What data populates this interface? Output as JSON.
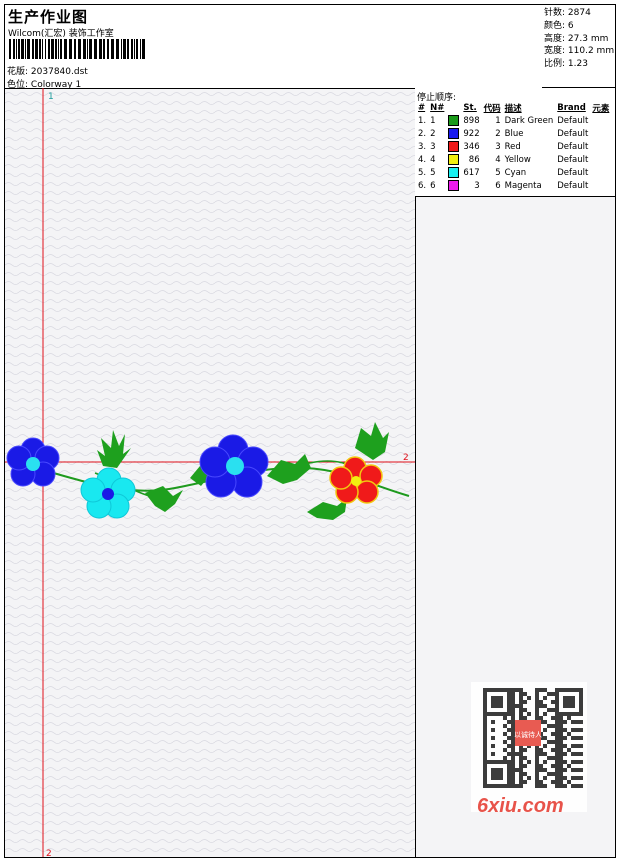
{
  "header": {
    "title": "生产作业图",
    "company": "Wilcom(汇宏) 装饰工作室",
    "design_label": "花版:",
    "design_value": "2037840.dst",
    "colorway_label": "色位:",
    "colorway_value": "Colorway 1"
  },
  "stats": [
    {
      "label": "针数:",
      "value": "2874"
    },
    {
      "label": "颜色:",
      "value": "6"
    },
    {
      "label": "高度:",
      "value": "27.3 mm"
    },
    {
      "label": "宽度:",
      "value": "110.2 mm"
    },
    {
      "label": "比例:",
      "value": "1.23"
    }
  ],
  "legend": {
    "title": "停止顺序:",
    "headers": [
      "#",
      "N#",
      "St.",
      "代码",
      "描述",
      "Brand",
      "元素"
    ],
    "rows": [
      {
        "n": "1.",
        "stop": "1",
        "color": "#1a9a1a",
        "st": "898",
        "code": "1",
        "desc": "Dark Green",
        "brand": "Default"
      },
      {
        "n": "2.",
        "stop": "2",
        "color": "#1a1aee",
        "st": "922",
        "code": "2",
        "desc": "Blue",
        "brand": "Default"
      },
      {
        "n": "3.",
        "stop": "3",
        "color": "#ee1a1a",
        "st": "346",
        "code": "3",
        "desc": "Red",
        "brand": "Default"
      },
      {
        "n": "4.",
        "stop": "4",
        "color": "#f2ee10",
        "st": "86",
        "code": "4",
        "desc": "Yellow",
        "brand": "Default"
      },
      {
        "n": "5.",
        "stop": "5",
        "color": "#19f0f0",
        "st": "617",
        "code": "5",
        "desc": "Cyan",
        "brand": "Default"
      },
      {
        "n": "6.",
        "stop": "6",
        "color": "#ee1aee",
        "st": "3",
        "code": "6",
        "desc": "Magenta",
        "brand": "Default"
      }
    ]
  },
  "canvas": {
    "marker_top": "1",
    "marker_bottom": "2",
    "marker_right": "2"
  },
  "watermark": {
    "text": "6xiu.com",
    "stamp": "以诚待人"
  }
}
